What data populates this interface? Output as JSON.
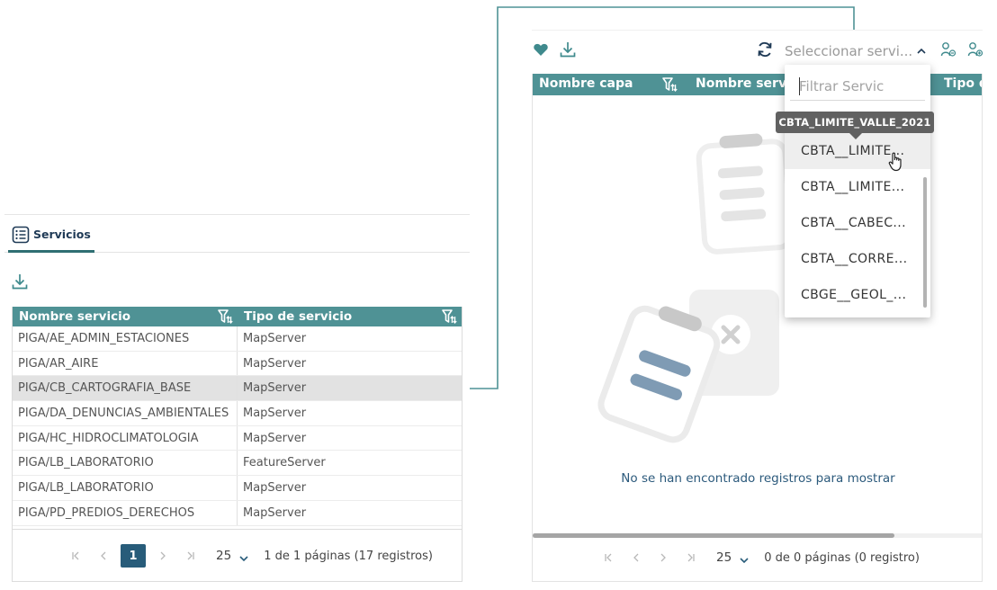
{
  "left_panel": {
    "tab": {
      "label": "Servicios",
      "icon": "list-icon"
    },
    "table": {
      "columns": [
        "Nombre servicio",
        "Tipo de servicio"
      ],
      "rows": [
        {
          "name": "PIGA/AE_ADMIN_ESTACIONES",
          "type": "MapServer"
        },
        {
          "name": "PIGA/AR_AIRE",
          "type": "MapServer"
        },
        {
          "name": "PIGA/CB_CARTOGRAFIA_BASE",
          "type": "MapServer",
          "selected": true
        },
        {
          "name": "PIGA/DA_DENUNCIAS_AMBIENTALES",
          "type": "MapServer"
        },
        {
          "name": "PIGA/HC_HIDROCLIMATOLOGIA",
          "type": "MapServer"
        },
        {
          "name": "PIGA/LB_LABORATORIO",
          "type": "FeatureServer"
        },
        {
          "name": "PIGA/LB_LABORATORIO",
          "type": "MapServer"
        },
        {
          "name": "PIGA/PD_PREDIOS_DERECHOS",
          "type": "MapServer"
        }
      ]
    },
    "pagination": {
      "current_page": "1",
      "page_size": "25",
      "info": "1 de 1 páginas (17 registros)"
    }
  },
  "right_panel": {
    "service_select": {
      "placeholder": "Seleccionar servi..."
    },
    "table": {
      "columns": [
        "Nombre capa",
        "Nombre servicio",
        "Tipo d"
      ]
    },
    "empty_message": "No se han encontrado registros para mostrar",
    "pagination": {
      "page_size": "25",
      "info": "0 de 0 páginas (0 registro)"
    }
  },
  "dropdown": {
    "filter_placeholder": "Filtrar Servic",
    "tooltip": "CBTA_LIMITE_VALLE_2021",
    "options": [
      "CBTA__LIMITE...",
      "CBTA__LIMITE...",
      "CBTA__CABEC...",
      "CBTA__CORRE...",
      "CBGE__GEOL_..."
    ]
  },
  "colors": {
    "teal_header": "#4f9295",
    "accent_teal": "#2f6f73",
    "navy": "#285c7a",
    "connector": "#3a8a8c",
    "empty_text": "#2c5a7c"
  }
}
